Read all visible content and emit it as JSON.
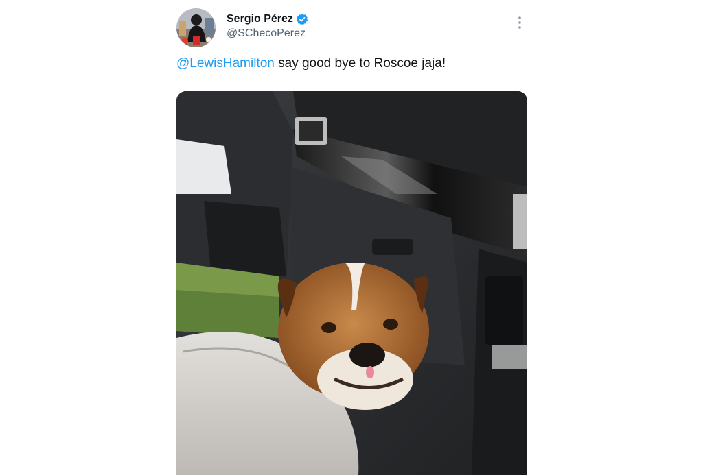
{
  "tweet": {
    "author": {
      "display_name": "Sergio Pérez",
      "handle": "@SChecoPerez",
      "verified": true,
      "avatar_icon": "profile-photo"
    },
    "text": {
      "mention": "@LewisHamilton",
      "body": " say good bye to Roscoe jaja!"
    },
    "more_icon": "more-options-icon",
    "colors": {
      "link": "#1d9bf0",
      "verified": "#1d9bf0",
      "text": "#0f1419",
      "secondary": "#536471"
    },
    "media": {
      "type": "photo",
      "subject": "bulldog-in-car-photo"
    }
  }
}
